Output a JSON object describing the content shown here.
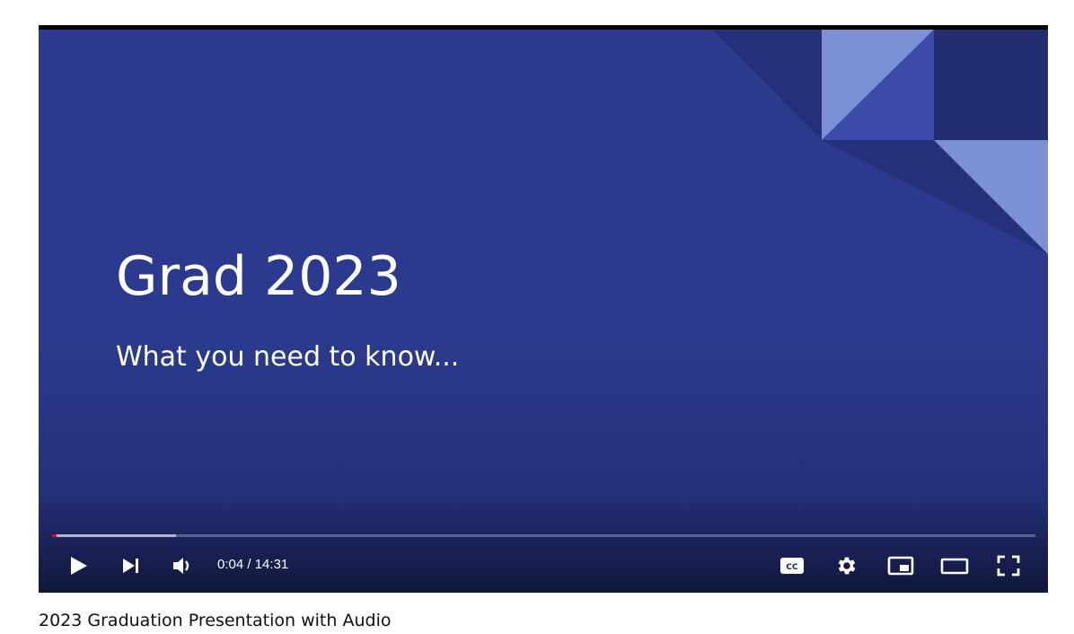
{
  "slide": {
    "title": "Grad 2023",
    "subtitle": "What you need to know..."
  },
  "player": {
    "current_time": "0:04",
    "duration": "14:31",
    "time_display": "0:04 / 14:31",
    "progress_played_fraction": 0.0046,
    "progress_loaded_fraction": 0.126,
    "accent_color": "#ff0000",
    "controls": [
      {
        "name": "play-button",
        "icon": "play-icon"
      },
      {
        "name": "next-button",
        "icon": "skip-next-icon"
      },
      {
        "name": "volume-button",
        "icon": "volume-icon"
      },
      {
        "name": "captions-button",
        "icon": "cc-icon"
      },
      {
        "name": "settings-button",
        "icon": "gear-icon"
      },
      {
        "name": "miniplayer-button",
        "icon": "miniplayer-icon"
      },
      {
        "name": "theater-mode-button",
        "icon": "theater-icon"
      },
      {
        "name": "fullscreen-button",
        "icon": "fullscreen-icon"
      }
    ]
  },
  "video": {
    "title": "2023 Graduation Presentation with Audio"
  }
}
